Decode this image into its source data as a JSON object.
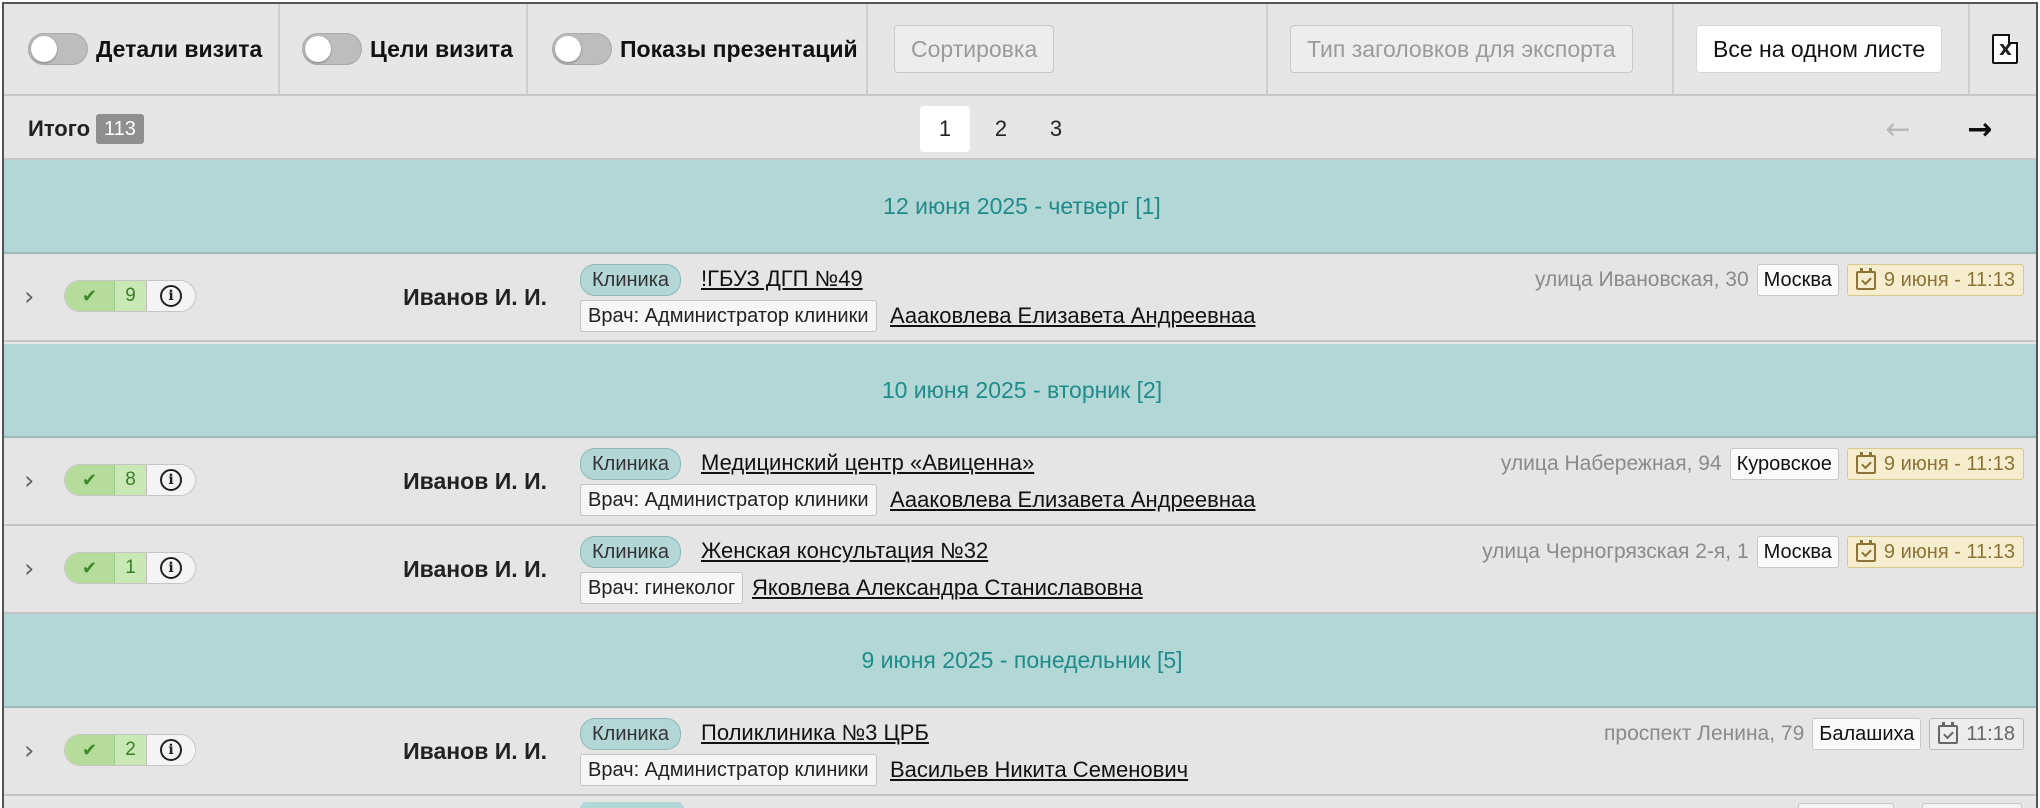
{
  "toolbar": {
    "toggles": [
      {
        "label": "Детали визита",
        "on": false
      },
      {
        "label": "Цели визита",
        "on": false
      },
      {
        "label": "Показы презентаций",
        "on": false
      }
    ],
    "sort_button": "Сортировка",
    "export_header_type": "Тип заголовков для экспорта",
    "all_on_one_sheet": "Все на одном листе",
    "export_icon": "excel-icon"
  },
  "pager": {
    "total_label": "Итого",
    "total_count": "113",
    "pages": [
      "1",
      "2",
      "3"
    ],
    "current_page": "1",
    "prev_icon": "arrow-left-icon",
    "next_icon": "arrow-right-icon"
  },
  "groups": [
    {
      "date": "12 июня 2025 - четверг [1]",
      "visits": [
        {
          "count": "9",
          "author": "Иванов И. И.",
          "clinic_tag": "Клиника",
          "clinic_name": "!ГБУЗ ДГП №49",
          "doctor_tag": "Врач: Администратор клиники",
          "doctor_name": "Аааковлева Елизавета Андреевнаа",
          "street": "улица Ивановская, 30",
          "city": "Москва",
          "time": "9 июня - 11:13"
        }
      ]
    },
    {
      "date": "10 июня 2025 - вторник [2]",
      "visits": [
        {
          "count": "8",
          "author": "Иванов И. И.",
          "clinic_tag": "Клиника",
          "clinic_name": "Медицинский центр «Авиценна»",
          "doctor_tag": "Врач: Администратор клиники",
          "doctor_name": "Аааковлева Елизавета Андреевнаа",
          "street": "улица Набережная, 94",
          "city": "Куровское",
          "time": "9 июня - 11:13"
        },
        {
          "count": "1",
          "author": "Иванов И. И.",
          "clinic_tag": "Клиника",
          "clinic_name": "Женская консультация №32",
          "doctor_tag": "Врач: гинеколог",
          "doctor_name": "Яковлева Александра Станиславовна",
          "street": "улица Черногрязская 2-я, 1",
          "city": "Москва",
          "time": "9 июня - 11:13"
        }
      ]
    },
    {
      "date": "9 июня 2025 - понедельник [5]",
      "visits": [
        {
          "count": "2",
          "author": "Иванов И. И.",
          "clinic_tag": "Клиника",
          "clinic_name": "Поликлиника №3 ЦРБ",
          "doctor_tag": "Врач: Администратор клиники",
          "doctor_name": "Васильев Никита Семенович",
          "street": "проспект Ленина, 79",
          "city": "Балашиха",
          "time": "11:18"
        }
      ]
    }
  ],
  "colors": {
    "group_header_bg": "#b3d7d6",
    "group_header_text": "#1f8c8a",
    "status_green": "#b6dc9c",
    "time_badge_bg": "#f6edcf"
  }
}
